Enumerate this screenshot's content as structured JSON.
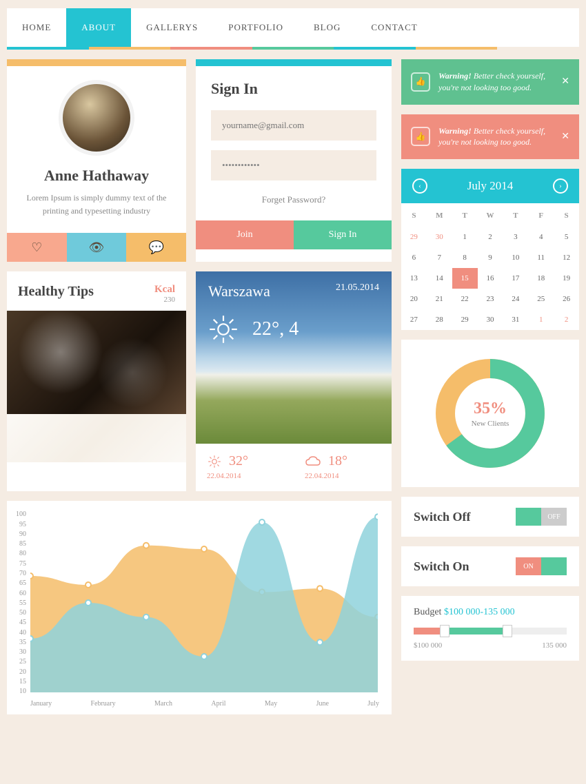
{
  "nav": {
    "items": [
      "HOME",
      "ABOUT",
      "GALLERYS",
      "PORTFOLIO",
      "BLOG",
      "CONTACT"
    ],
    "active": "ABOUT"
  },
  "profile": {
    "name": "Anne Hathaway",
    "desc": "Lorem Ipsum is simply dummy text of the printing and typesetting industry"
  },
  "signin": {
    "title": "Sign In",
    "email_placeholder": "yourname@gmail.com",
    "pwd_value": "••••••••••••",
    "forgot": "Forget Password?",
    "join": "Join",
    "signin": "Sign In"
  },
  "healthy": {
    "title": "Healthy Tips",
    "kcal_label": "Kcal",
    "kcal_value": "230"
  },
  "weather": {
    "city": "Warszawa",
    "date": "21.05.2014",
    "temp": "22°, 4",
    "f1_temp": "32°",
    "f1_date": "22.04.2014",
    "f2_temp": "18°",
    "f2_date": "22.04.2014"
  },
  "alerts": {
    "warn_bold": "Warning!",
    "warn_text": " Better check yourself, you're not looking too good."
  },
  "calendar": {
    "month": "July 2014",
    "dow": [
      "S",
      "M",
      "T",
      "W",
      "T",
      "F",
      "S"
    ],
    "prev_days": [
      29,
      30
    ],
    "days": [
      1,
      2,
      3,
      4,
      5,
      6,
      7,
      8,
      9,
      10,
      11,
      12,
      13,
      14,
      15,
      16,
      17,
      18,
      19,
      20,
      21,
      22,
      23,
      24,
      25,
      26,
      27,
      28,
      29,
      30,
      31
    ],
    "next_days": [
      1,
      2
    ],
    "selected": 15
  },
  "donut": {
    "pct": "35%",
    "label": "New Clients"
  },
  "switch": {
    "off_label": "Switch Off",
    "on_label": "Switch On",
    "off": "OFF",
    "on": "ON"
  },
  "budget": {
    "title": "Budget ",
    "range": "$100 000-135 000",
    "min": "$100 000",
    "max": "135 000"
  },
  "chart_data": {
    "type": "area",
    "x": [
      "January",
      "February",
      "March",
      "April",
      "May",
      "June",
      "July"
    ],
    "ylim": [
      0,
      100
    ],
    "yticks": [
      10,
      15,
      20,
      25,
      30,
      35,
      40,
      45,
      50,
      55,
      60,
      65,
      70,
      75,
      80,
      85,
      90,
      95,
      100
    ],
    "series": [
      {
        "name": "orange",
        "color": "#f5bd6a",
        "values": [
          65,
          60,
          82,
          80,
          56,
          58,
          42
        ]
      },
      {
        "name": "blue",
        "color": "#8fd2dc",
        "values": [
          30,
          50,
          42,
          20,
          95,
          28,
          98
        ]
      }
    ]
  }
}
